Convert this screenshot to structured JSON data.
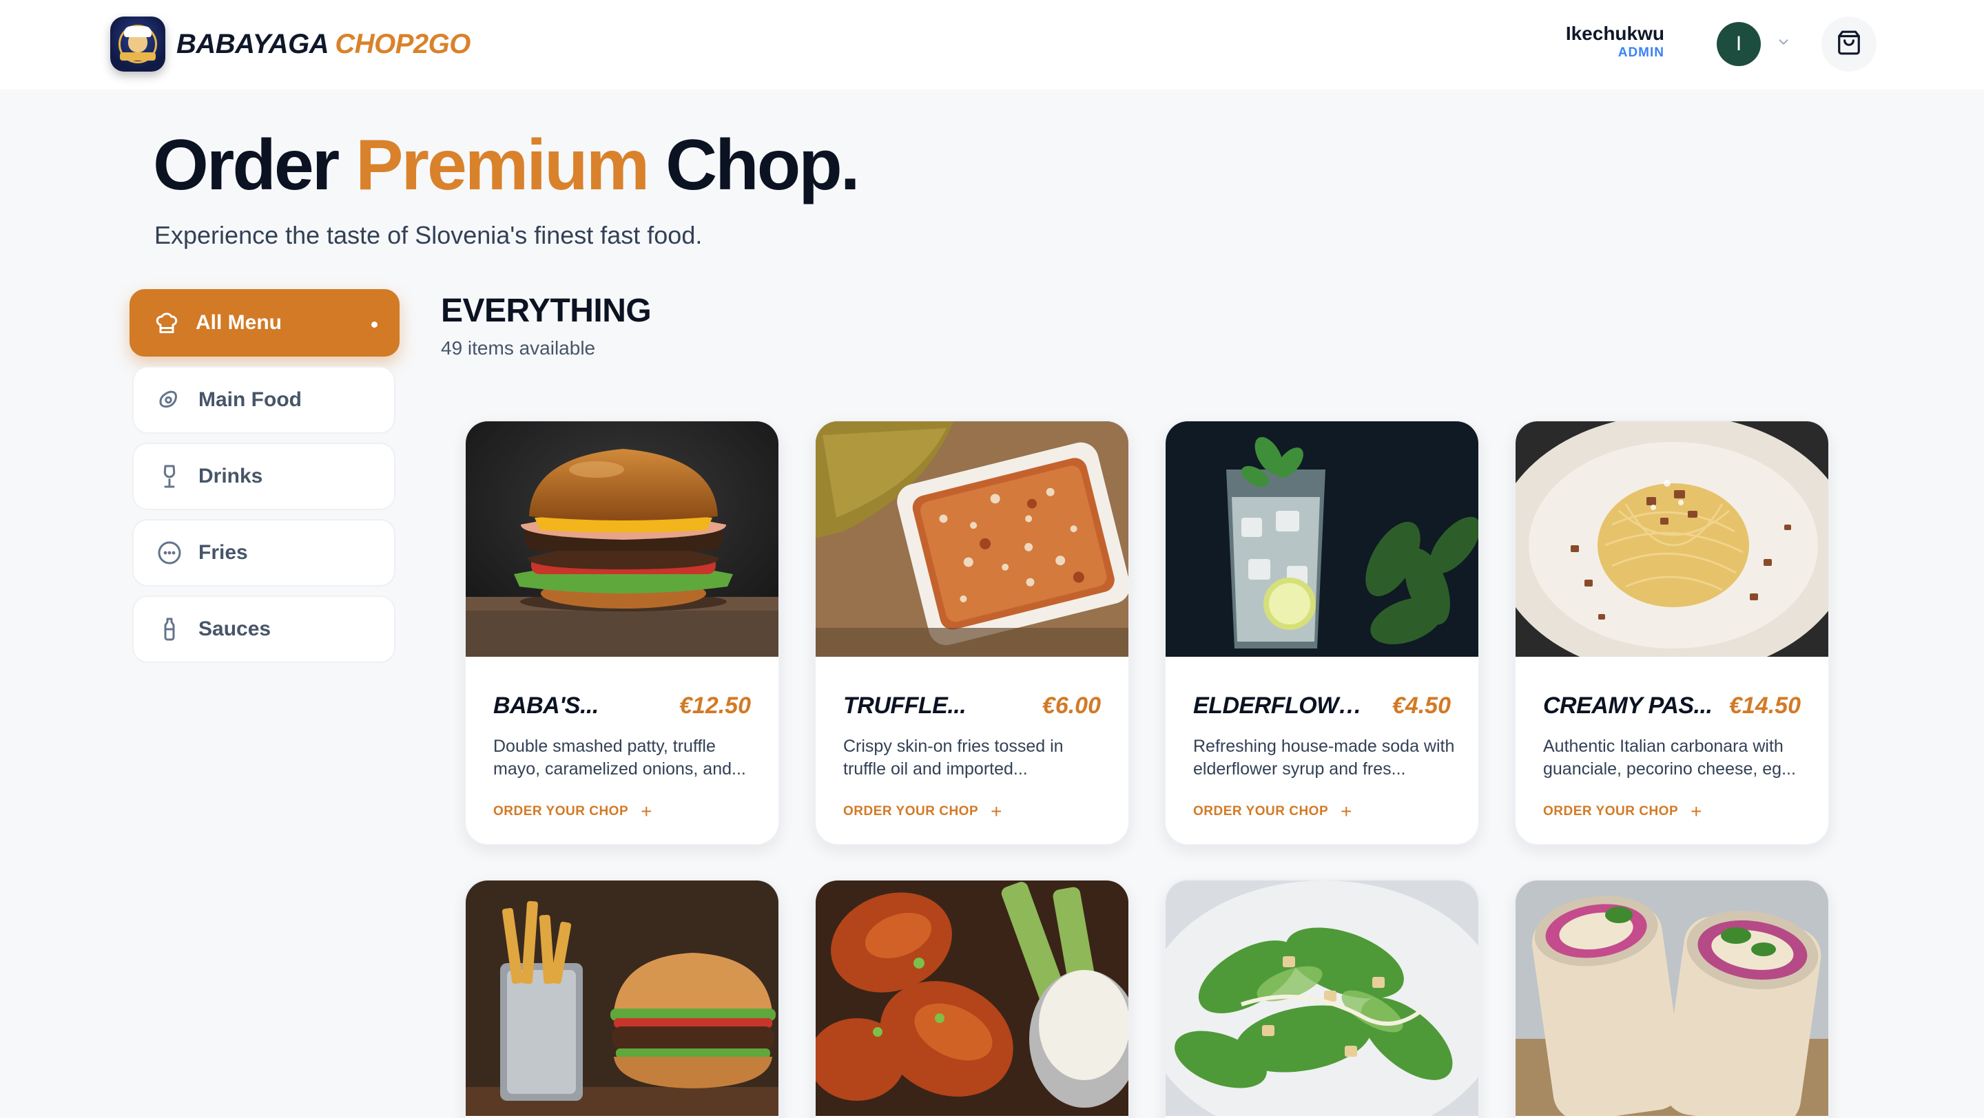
{
  "header": {
    "brand_part1": "BABAYAGA",
    "brand_part2": "CHOP2GO",
    "user_name": "Ikechukwu",
    "user_role": "ADMIN",
    "avatar_initial": "I",
    "cart_icon": "shopping-bag-icon"
  },
  "hero": {
    "title_part1": "Order",
    "title_part2": "Premium",
    "title_part3": "Chop.",
    "subtitle": "Experience the taste of Slovenia's finest fast food."
  },
  "sidebar": {
    "items": [
      {
        "label": "All Menu",
        "icon": "chef-hat-icon",
        "active": true
      },
      {
        "label": "Main Food",
        "icon": "steak-icon",
        "active": false
      },
      {
        "label": "Drinks",
        "icon": "wine-glass-icon",
        "active": false
      },
      {
        "label": "Fries",
        "icon": "dots-circle-icon",
        "active": false
      },
      {
        "label": "Sauces",
        "icon": "bottle-icon",
        "active": false
      }
    ]
  },
  "section": {
    "title": "EVERYTHING",
    "count": "49 items available"
  },
  "products": [
    {
      "name": "BABA'S...",
      "price": "€12.50",
      "desc": "Double smashed patty, truffle mayo, caramelized onions, and...",
      "cta": "ORDER YOUR CHOP"
    },
    {
      "name": "TRUFFLE...",
      "price": "€6.00",
      "desc": "Crispy skin-on fries tossed in truffle oil and imported...",
      "cta": "ORDER YOUR CHOP"
    },
    {
      "name": "ELDERFLOWER...",
      "price": "€4.50",
      "desc": "Refreshing house-made soda with elderflower syrup and fres...",
      "cta": "ORDER YOUR CHOP"
    },
    {
      "name": "CREAMY PAS...",
      "price": "€14.50",
      "desc": "Authentic Italian carbonara with guanciale, pecorino cheese, eg...",
      "cta": "ORDER YOUR CHOP"
    }
  ],
  "colors": {
    "accent": "#d27a26",
    "text_dark": "#0b1222",
    "admin_blue": "#3b82f6",
    "avatar_green": "#1d4d3f"
  }
}
